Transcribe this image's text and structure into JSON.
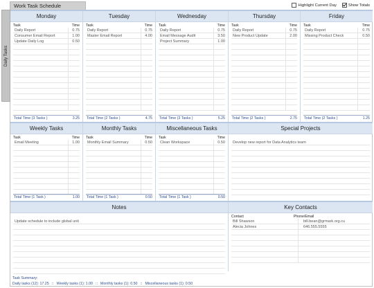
{
  "title": "Work Task Schedule",
  "side_tab": "Daily Tasks",
  "options": {
    "highlight": "Highlight Current Day",
    "show_totals": "Show Totals"
  },
  "col_task": "Task",
  "col_time": "Time",
  "days": [
    {
      "name": "Monday",
      "tasks": [
        [
          "Daily Report",
          "0.75"
        ],
        [
          "Consumer Email Report",
          "1.00"
        ],
        [
          "Update Daily Log",
          "0.50"
        ]
      ],
      "total_label": "Total Time (3 Tasks )",
      "total": "3.25"
    },
    {
      "name": "Tuesday",
      "tasks": [
        [
          "Daily Report",
          "0.75"
        ],
        [
          "Master Email Report",
          "4.00"
        ]
      ],
      "total_label": "Total Time (2 Tasks )",
      "total": "4.75"
    },
    {
      "name": "Wednesday",
      "tasks": [
        [
          "Daily Report",
          "0.75"
        ],
        [
          "Email Message Audit",
          "3.50"
        ],
        [
          "Project Summary",
          "1.00"
        ]
      ],
      "total_label": "Total Time (3 Tasks )",
      "total": "5.25"
    },
    {
      "name": "Thursday",
      "tasks": [
        [
          "Daily Report",
          "0.75"
        ],
        [
          "New Product Update",
          "2.00"
        ]
      ],
      "total_label": "Total Time (2 Tasks )",
      "total": "2.75"
    },
    {
      "name": "Friday",
      "tasks": [
        [
          "Daily Report",
          "0.75"
        ],
        [
          "Missing Product Check",
          "0.50"
        ]
      ],
      "total_label": "Total Time (2 Tasks )",
      "total": "1.25"
    }
  ],
  "categories": [
    {
      "name": "Weekly Tasks",
      "tasks": [
        [
          "Email Meeting",
          "1.00"
        ]
      ],
      "total_label": "Total Time (1 Task )",
      "total": "1.00"
    },
    {
      "name": "Monthly Tasks",
      "tasks": [
        [
          "Monthly Email Summary",
          "0.50"
        ]
      ],
      "total_label": "Total Time (1 Task )",
      "total": "0.50"
    },
    {
      "name": "Miscellaneous Tasks",
      "tasks": [
        [
          "Clean Workspace",
          "0.50"
        ]
      ],
      "total_label": "Total Time (1 Task )",
      "total": "0.50"
    }
  ],
  "special": {
    "title": "Special Projects",
    "items": [
      "Develop new report for Data Analytics team"
    ]
  },
  "notes": {
    "title": "Notes",
    "items": [
      "Update schedule to include global unit"
    ]
  },
  "contacts": {
    "title": "Key Contacts",
    "col_contact": "Contact",
    "col_phone": "Phone/Email",
    "items": [
      [
        "Bill Shawson",
        "bill.bean@grmark.org.cu"
      ],
      [
        "Alecia Johnes",
        "646.555.5555"
      ]
    ]
  },
  "summary": {
    "label": "Task Summary:",
    "items": [
      "Daily tasks (12): 17.25",
      "::",
      "Weekly tasks (1): 1.00",
      "::",
      "Monthly tasks (1): 0.50",
      "::",
      "Miscellaneous tasks (1): 0.50"
    ]
  }
}
